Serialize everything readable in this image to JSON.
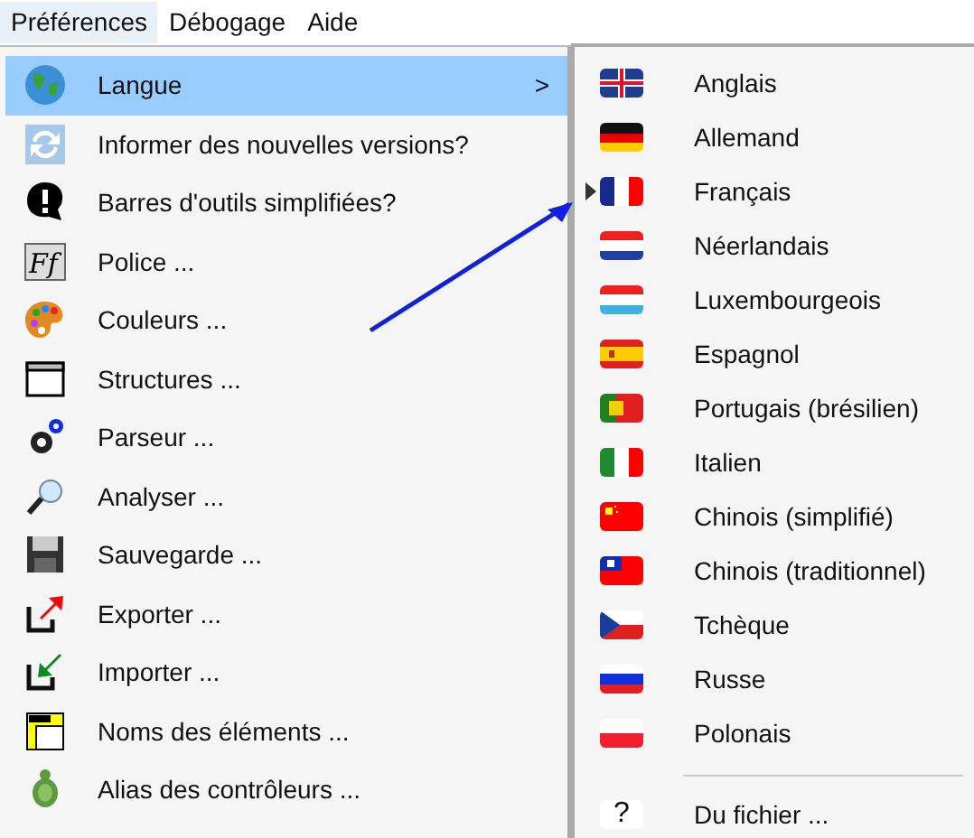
{
  "menubar": [
    {
      "label": "Préférences",
      "selected": true
    },
    {
      "label": "Débogage",
      "selected": false
    },
    {
      "label": "Aide",
      "selected": false
    }
  ],
  "menu": {
    "items": [
      {
        "label": "Langue",
        "selected": true,
        "submenu_arrow": ">"
      },
      {
        "label": "Informer des nouvelles versions?",
        "selected": false
      },
      {
        "label": "Barres d'outils simplifiées?",
        "selected": false
      },
      {
        "label": "Police ...",
        "selected": false,
        "icon_text": "Ff"
      },
      {
        "label": "Couleurs ...",
        "selected": false
      },
      {
        "label": "Structures ...",
        "selected": false
      },
      {
        "label": "Parseur ...",
        "selected": false
      },
      {
        "label": "Analyser ...",
        "selected": false
      },
      {
        "label": "Sauvegarde ...",
        "selected": false
      },
      {
        "label": "Exporter ...",
        "selected": false
      },
      {
        "label": "Importer ...",
        "selected": false
      },
      {
        "label": "Noms des éléments ...",
        "selected": false
      },
      {
        "label": "Alias des contrôleurs ...",
        "selected": false
      }
    ]
  },
  "submenu": {
    "items": [
      {
        "label": "Anglais",
        "selected": false
      },
      {
        "label": "Allemand",
        "selected": false
      },
      {
        "label": "Français",
        "selected": true
      },
      {
        "label": "Néerlandais",
        "selected": false
      },
      {
        "label": "Luxembourgeois",
        "selected": false
      },
      {
        "label": "Espagnol",
        "selected": false
      },
      {
        "label": "Portugais (brésilien)",
        "selected": false
      },
      {
        "label": "Italien",
        "selected": false
      },
      {
        "label": "Chinois (simplifié)",
        "selected": false
      },
      {
        "label": "Chinois (traditionnel)",
        "selected": false
      },
      {
        "label": "Tchèque",
        "selected": false
      },
      {
        "label": "Russe",
        "selected": false
      },
      {
        "label": "Polonais",
        "selected": false
      }
    ],
    "file_item": {
      "icon_text": "?",
      "label": "Du fichier ..."
    }
  }
}
